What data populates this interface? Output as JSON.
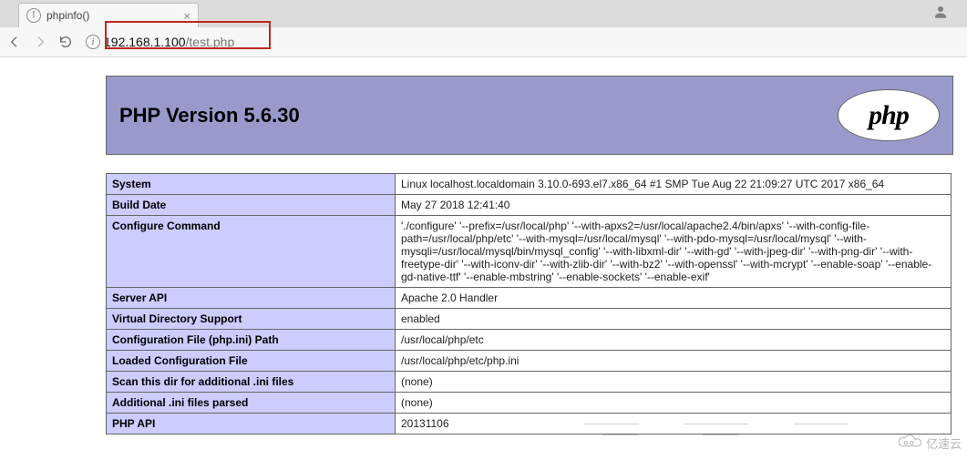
{
  "browser": {
    "tab_title": "phpinfo()",
    "url_host": "192.168.1.100",
    "url_path": "/test.php"
  },
  "header": {
    "title": "PHP Version 5.6.30",
    "logo_text": "php"
  },
  "rows": [
    {
      "key": "System",
      "value": "Linux localhost.localdomain 3.10.0-693.el7.x86_64 #1 SMP Tue Aug 22 21:09:27 UTC 2017 x86_64"
    },
    {
      "key": "Build Date",
      "value": "May 27 2018 12:41:40"
    },
    {
      "key": "Configure Command",
      "value": "'./configure' '--prefix=/usr/local/php' '--with-apxs2=/usr/local/apache2.4/bin/apxs' '--with-config-file-path=/usr/local/php/etc' '--with-mysql=/usr/local/mysql' '--with-pdo-mysql=/usr/local/mysql' '--with-mysqli=/usr/local/mysql/bin/mysql_config' '--with-libxml-dir' '--with-gd' '--with-jpeg-dir' '--with-png-dir' '--with-freetype-dir' '--with-iconv-dir' '--with-zlib-dir' '--with-bz2' '--with-openssl' '--with-mcrypt' '--enable-soap' '--enable-gd-native-ttf' '--enable-mbstring' '--enable-sockets' '--enable-exif'"
    },
    {
      "key": "Server API",
      "value": "Apache 2.0 Handler"
    },
    {
      "key": "Virtual Directory Support",
      "value": "enabled"
    },
    {
      "key": "Configuration File (php.ini) Path",
      "value": "/usr/local/php/etc"
    },
    {
      "key": "Loaded Configuration File",
      "value": "/usr/local/php/etc/php.ini"
    },
    {
      "key": "Scan this dir for additional .ini files",
      "value": "(none)"
    },
    {
      "key": "Additional .ini files parsed",
      "value": "(none)"
    },
    {
      "key": "PHP API",
      "value": "20131106"
    }
  ],
  "watermark": "亿速云"
}
